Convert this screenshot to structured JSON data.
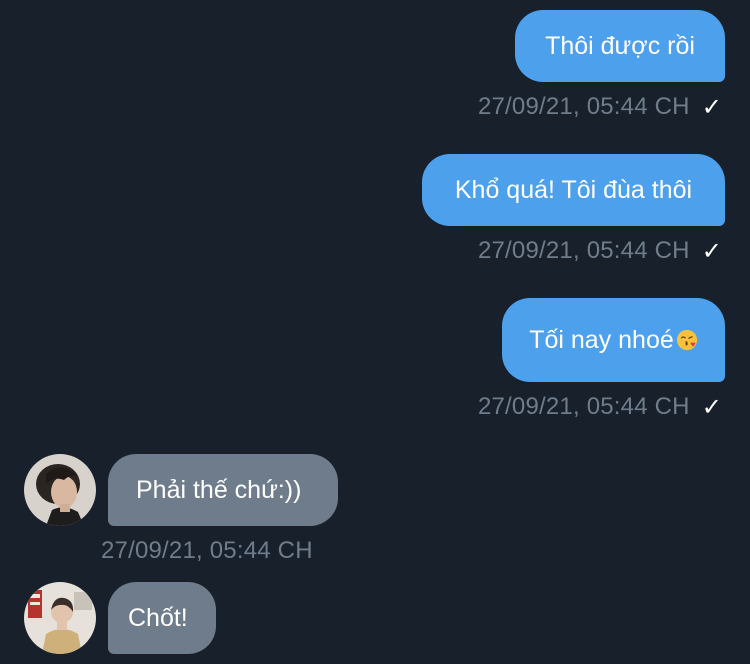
{
  "messages": [
    {
      "text": "Thôi được rồi",
      "time": "27/09/21, 05:44 CH",
      "check": "✓"
    },
    {
      "text": "Khổ quá! Tôi đùa thôi",
      "time": "27/09/21, 05:44 CH",
      "check": "✓"
    },
    {
      "text": "Tối nay nhoé",
      "emoji": "kissing-face-emoji",
      "time": "27/09/21, 05:44 CH",
      "check": "✓"
    },
    {
      "text": "Phải thế chứ:))",
      "time": "27/09/21, 05:44 CH"
    },
    {
      "text": "Chốt!"
    }
  ],
  "colors": {
    "background": "#18202b",
    "outgoing_bubble": "#4da0ec",
    "incoming_bubble": "#6e7c8c",
    "timestamp": "#6f7c8b"
  }
}
